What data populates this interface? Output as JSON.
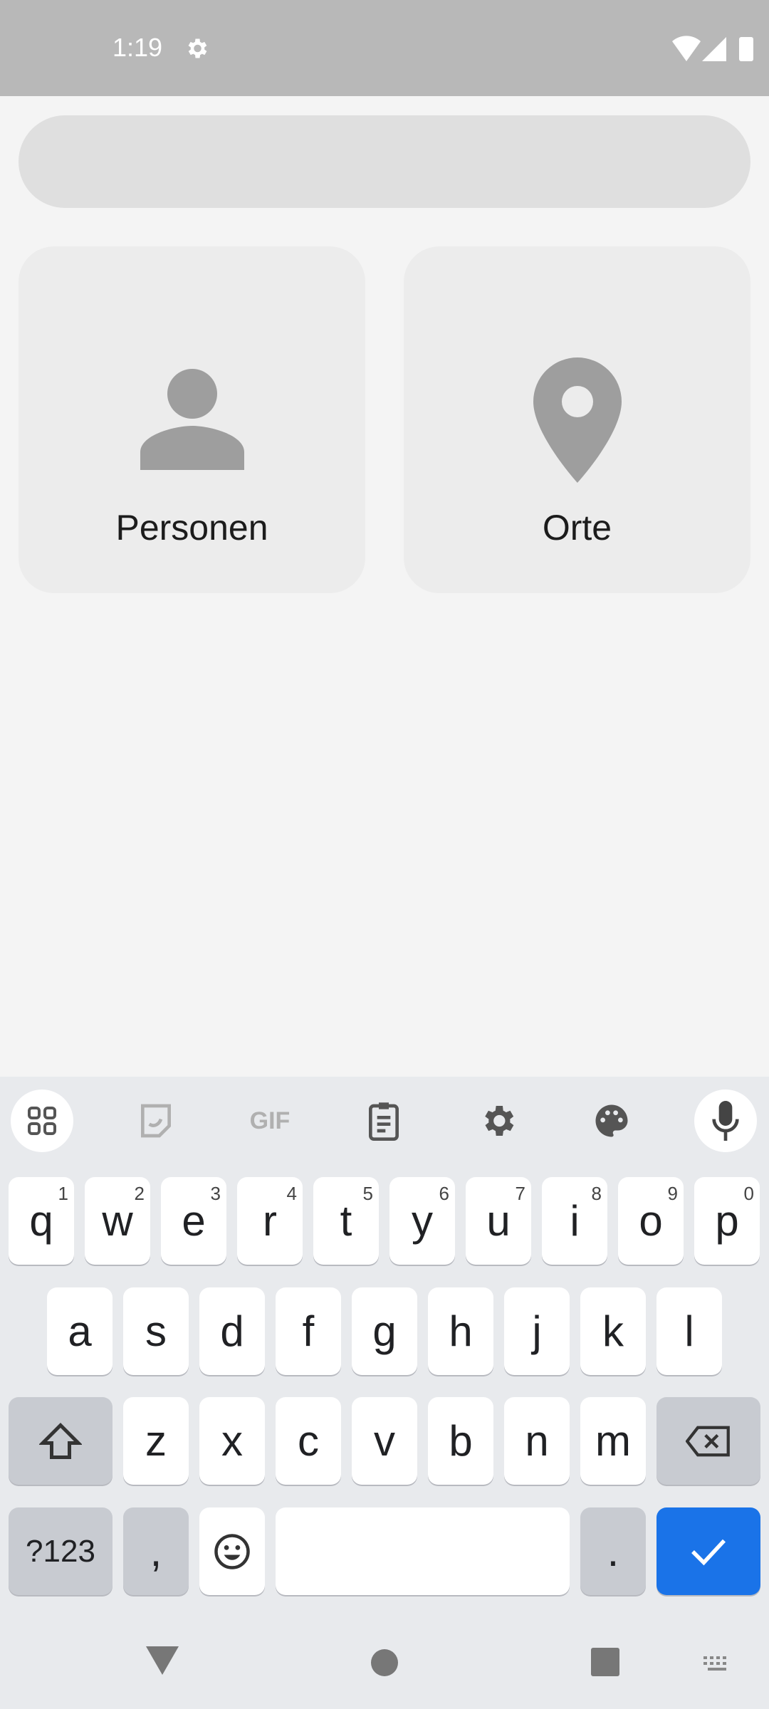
{
  "status_bar": {
    "time": "1:19"
  },
  "cards": [
    {
      "label": "Personen",
      "icon": "person-icon"
    },
    {
      "label": "Orte",
      "icon": "location-pin-icon"
    }
  ],
  "keyboard": {
    "toolbar": [
      "apps-grid-icon",
      "sticker-icon",
      "gif-icon",
      "clipboard-icon",
      "settings-icon",
      "palette-icon",
      "microphone-icon"
    ],
    "gif_label": "GIF",
    "row1": [
      {
        "k": "q",
        "n": "1"
      },
      {
        "k": "w",
        "n": "2"
      },
      {
        "k": "e",
        "n": "3"
      },
      {
        "k": "r",
        "n": "4"
      },
      {
        "k": "t",
        "n": "5"
      },
      {
        "k": "y",
        "n": "6"
      },
      {
        "k": "u",
        "n": "7"
      },
      {
        "k": "i",
        "n": "8"
      },
      {
        "k": "o",
        "n": "9"
      },
      {
        "k": "p",
        "n": "0"
      }
    ],
    "row2": [
      "a",
      "s",
      "d",
      "f",
      "g",
      "h",
      "j",
      "k",
      "l"
    ],
    "row3": [
      "z",
      "x",
      "c",
      "v",
      "b",
      "n",
      "m"
    ],
    "symbols": "?123",
    "comma": ",",
    "period": ".",
    "accent": "#1a73e8"
  }
}
